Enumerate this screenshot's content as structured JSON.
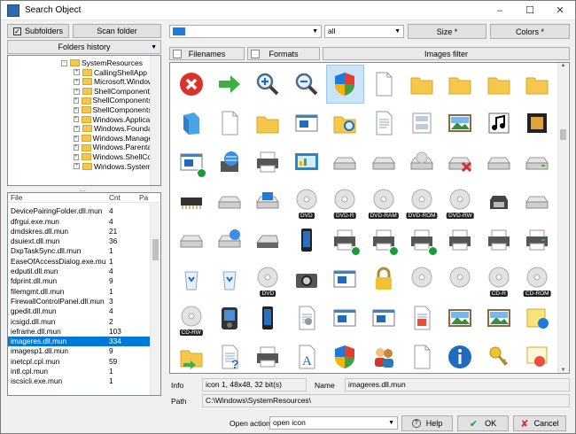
{
  "window": {
    "title": "Search Object"
  },
  "toolbar": {
    "subfolders": "Subfolders",
    "scan_folder": "Scan folder",
    "folders_history": "Folders history",
    "filter_all": "all",
    "size": "Size *",
    "colors": "Colors *",
    "filenames": "Filenames",
    "formats": "Formats",
    "images_filter": "Images filter"
  },
  "tree": {
    "root": "SystemResources",
    "items": [
      "CallingShellApp",
      "Microsoft.Windows.",
      "ShellComponents",
      "ShellComponents.Dr",
      "ShellComponents.Inf",
      "Windows.Application",
      "Windows.Foundatio",
      "Windows.Manageme",
      "Windows.ParentalCo",
      "Windows.ShellComm",
      "Windows.SystemTo"
    ]
  },
  "list": {
    "headers": [
      "File",
      "Cnt",
      "Pa"
    ],
    "rows": [
      [
        "DevicePairingFolder.dll.mun",
        "4"
      ],
      [
        "dfrgui.exe.mun",
        "4"
      ],
      [
        "dmdskres.dll.mun",
        "21"
      ],
      [
        "dsuiext.dll.mun",
        "36"
      ],
      [
        "DxpTaskSync.dll.mun",
        "1"
      ],
      [
        "EaseOfAccessDialog.exe.mun",
        "1"
      ],
      [
        "edputil.dll.mun",
        "4"
      ],
      [
        "fdprint.dll.mun",
        "9"
      ],
      [
        "filemgmt.dll.mun",
        "1"
      ],
      [
        "FirewallControlPanel.dll.mun",
        "3"
      ],
      [
        "gpedit.dll.mun",
        "4"
      ],
      [
        "icsigd.dll.mun",
        "2"
      ],
      [
        "ieframe.dll.mun",
        "103"
      ],
      [
        "imageres.dll.mun",
        "334"
      ],
      [
        "imagesp1.dll.mun",
        "9"
      ],
      [
        "inetcpl.cpl.mun",
        "59"
      ],
      [
        "intl.cpl.mun",
        "1"
      ],
      [
        "iscsicli.exe.mun",
        "1"
      ]
    ],
    "selected_index": 13
  },
  "icons": [
    {
      "n": "error-icon"
    },
    {
      "n": "arrow-right-icon"
    },
    {
      "n": "zoom-in-icon"
    },
    {
      "n": "zoom-out-icon"
    },
    {
      "n": "shield-icon"
    },
    {
      "n": "document-icon"
    },
    {
      "n": "folder-icon"
    },
    {
      "n": "folder-open-icon"
    },
    {
      "n": "folder-icon"
    },
    {
      "n": "folder-thin-icon"
    },
    {
      "n": "3d-objects-icon"
    },
    {
      "n": "blank-page-icon"
    },
    {
      "n": "folder-side-icon"
    },
    {
      "n": "window-icon"
    },
    {
      "n": "folder-search-icon"
    },
    {
      "n": "text-document-icon"
    },
    {
      "n": "slides-icon"
    },
    {
      "n": "picture-icon"
    },
    {
      "n": "music-icon"
    },
    {
      "n": "video-icon"
    },
    {
      "n": "window-check-icon"
    },
    {
      "n": "network-globe-icon"
    },
    {
      "n": "printer-icon"
    },
    {
      "n": "control-panel-icon"
    },
    {
      "n": "drive-icon"
    },
    {
      "n": "drive-icon"
    },
    {
      "n": "cd-drive-icon"
    },
    {
      "n": "drive-error-icon"
    },
    {
      "n": "drive-icon"
    },
    {
      "n": "drive-green-icon"
    },
    {
      "n": "memory-chip-icon"
    },
    {
      "n": "drive-icon"
    },
    {
      "n": "windows-drive-icon"
    },
    {
      "n": "dvd-icon",
      "l": "DVD"
    },
    {
      "n": "dvd-r-icon",
      "l": "DVD-R"
    },
    {
      "n": "dvd-ram-icon",
      "l": "DVD-RAM"
    },
    {
      "n": "dvd-rom-icon",
      "l": "DVD-ROM"
    },
    {
      "n": "dvd-rw-icon",
      "l": "DVD-RW"
    },
    {
      "n": "floppy-icon"
    },
    {
      "n": "drive-icon"
    },
    {
      "n": "usb-drive-icon"
    },
    {
      "n": "network-drive-icon"
    },
    {
      "n": "scanner-icon"
    },
    {
      "n": "phone-icon"
    },
    {
      "n": "printer-check-icon"
    },
    {
      "n": "printer-check-icon"
    },
    {
      "n": "printer-check-icon"
    },
    {
      "n": "printer-icon"
    },
    {
      "n": "printer-icon"
    },
    {
      "n": "printer-green-icon"
    },
    {
      "n": "recycle-bin-empty-icon"
    },
    {
      "n": "recycle-bin-full-icon"
    },
    {
      "n": "dvd-disc-icon",
      "l": "DVD"
    },
    {
      "n": "camera-icon"
    },
    {
      "n": "window-settings-icon"
    },
    {
      "n": "lock-icon"
    },
    {
      "n": "cd-icon"
    },
    {
      "n": "cd-icon"
    },
    {
      "n": "cd-r-icon",
      "l": "CD-R"
    },
    {
      "n": "cd-rom-icon",
      "l": "CD-ROM"
    },
    {
      "n": "cd-rw-icon",
      "l": "CD-RW"
    },
    {
      "n": "media-player-icon"
    },
    {
      "n": "mp3-player-icon"
    },
    {
      "n": "settings-doc-icon"
    },
    {
      "n": "window-gear-icon"
    },
    {
      "n": "gear-window-icon"
    },
    {
      "n": "image-doc-icon"
    },
    {
      "n": "landscape-icon"
    },
    {
      "n": "landscape-icon"
    },
    {
      "n": "sticky-note-icon"
    },
    {
      "n": "folder-arrow-icon"
    },
    {
      "n": "help-doc-icon"
    },
    {
      "n": "printer-icon"
    },
    {
      "n": "font-icon"
    },
    {
      "n": "shield-icon"
    },
    {
      "n": "users-icon"
    },
    {
      "n": "page-icon"
    },
    {
      "n": "info-icon"
    },
    {
      "n": "key-icon"
    },
    {
      "n": "certificate-icon"
    }
  ],
  "selected_icon": 4,
  "info": {
    "info_label": "Info",
    "info_value": "icon 1, 48x48, 32 bit(s)",
    "name_label": "Name",
    "name_value": "imageres.dll.mun",
    "path_label": "Path",
    "path_value": "C:\\Windows\\SystemResources\\"
  },
  "bottom": {
    "open_action_label": "Open action",
    "open_action_value": "open icon",
    "help": "Help",
    "ok": "OK",
    "cancel": "Cancel"
  },
  "colors": {
    "accent": "#0078d7",
    "folder": "#f5c84c"
  }
}
